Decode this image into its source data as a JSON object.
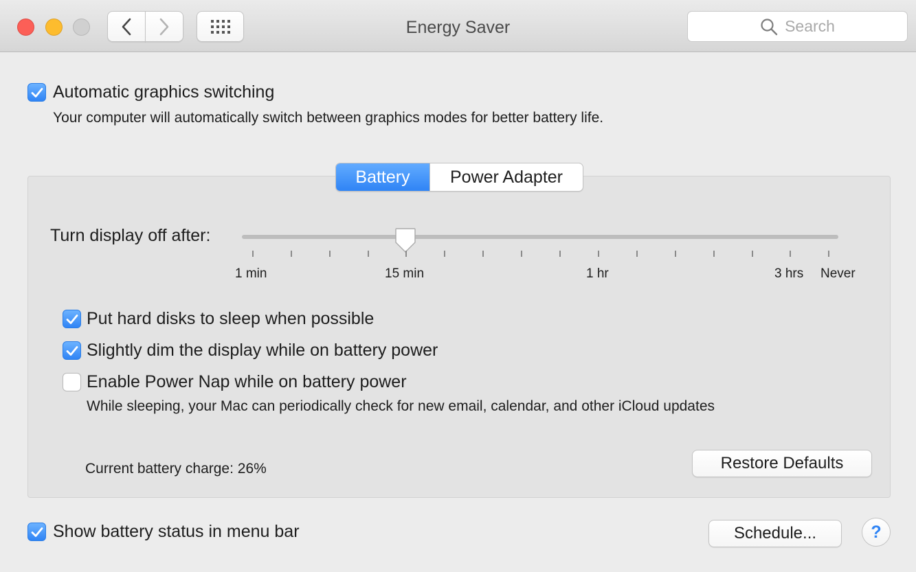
{
  "window": {
    "title": "Energy Saver"
  },
  "search": {
    "placeholder": "Search"
  },
  "top": {
    "auto_graphics": {
      "label": "Automatic graphics switching",
      "description": "Your computer will automatically switch between graphics modes for better battery life.",
      "checked": true
    }
  },
  "tabs": [
    {
      "label": "Battery",
      "active": true
    },
    {
      "label": "Power Adapter",
      "active": false
    }
  ],
  "display_sleep": {
    "label": "Turn display off after:",
    "tick_labels": [
      "1 min",
      "15 min",
      "1 hr",
      "3 hrs",
      "Never"
    ],
    "value_label": "15 min"
  },
  "options": [
    {
      "label": "Put hard disks to sleep when possible",
      "checked": true
    },
    {
      "label": "Slightly dim the display while on battery power",
      "checked": true
    },
    {
      "label": "Enable Power Nap while on battery power",
      "checked": false,
      "description": "While sleeping, your Mac can periodically check for new email, calendar, and other iCloud updates"
    }
  ],
  "battery": {
    "charge_text": "Current battery charge: 26%"
  },
  "buttons": {
    "restore": "Restore Defaults",
    "schedule": "Schedule...",
    "help": "?"
  },
  "bottom": {
    "show_status": {
      "label": "Show battery status in menu bar",
      "checked": true
    }
  },
  "colors": {
    "accent": "#2f84f5",
    "close": "#fc5f57",
    "minimize": "#fdbc2e",
    "zoom": "#d0d0d0"
  }
}
